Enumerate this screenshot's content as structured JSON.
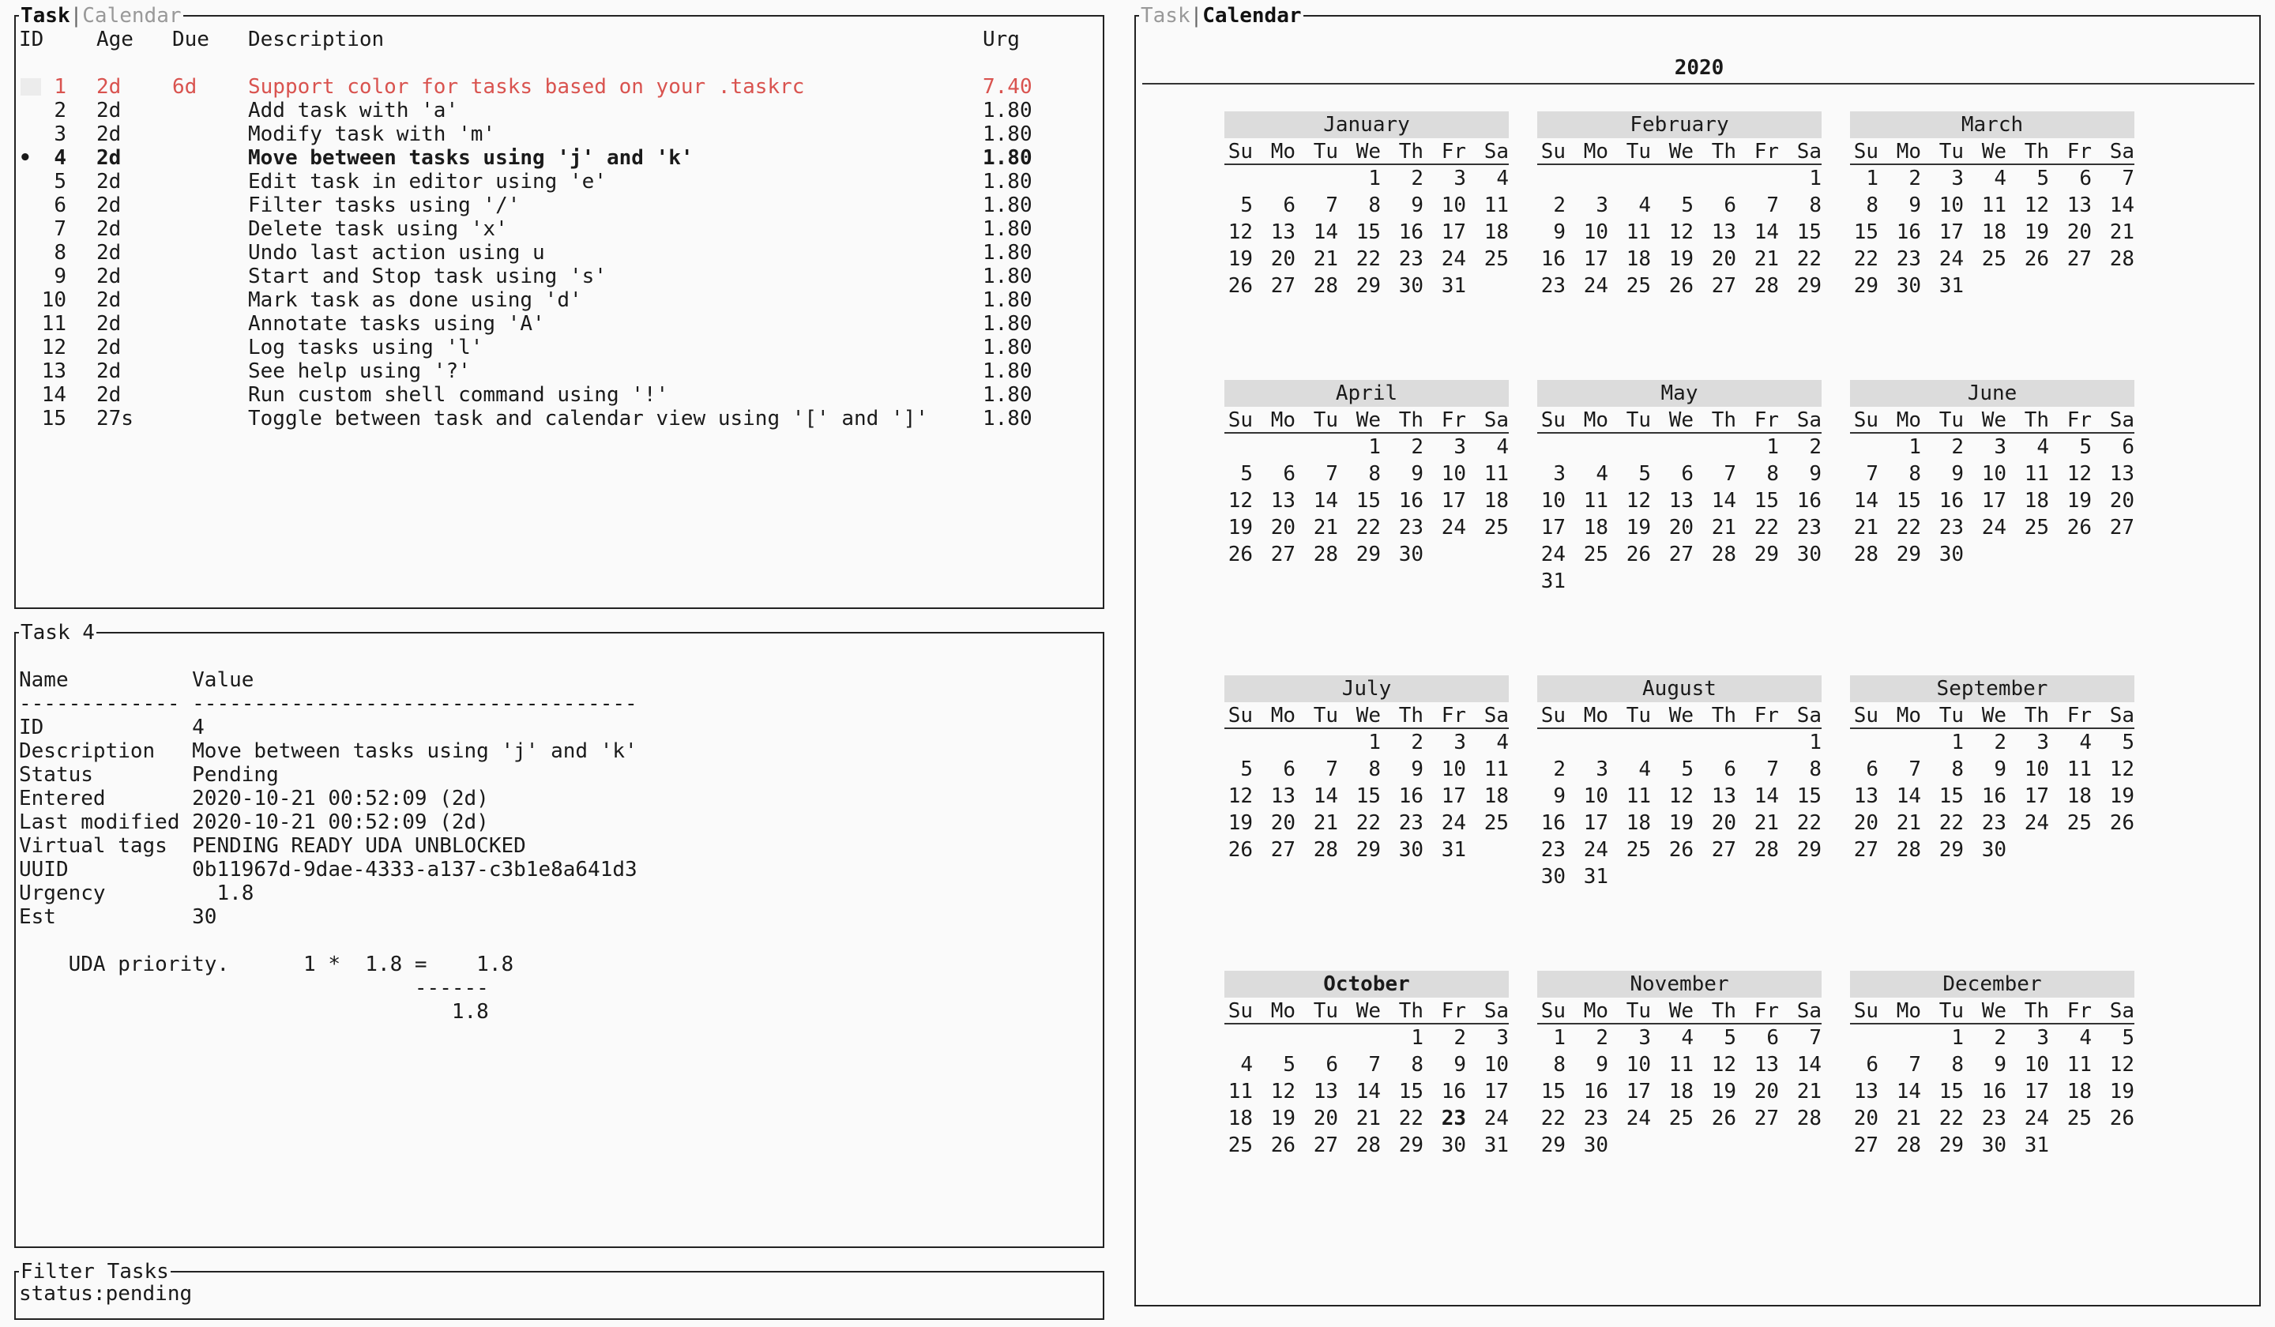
{
  "tabs": {
    "task": "Task",
    "calendar": "Calendar",
    "separator": "|"
  },
  "task_list": {
    "headers": {
      "id": "ID",
      "age": "Age",
      "due": "Due",
      "description": "Description",
      "urgency": "Urg"
    },
    "rows": [
      {
        "id": "1",
        "age": "2d",
        "due": "6d",
        "description": "Support color for tasks based on your .taskrc",
        "urgency": "7.40",
        "style": "red",
        "marker": ""
      },
      {
        "id": "2",
        "age": "2d",
        "due": "",
        "description": "Add task with 'a'",
        "urgency": "1.80",
        "style": "",
        "marker": ""
      },
      {
        "id": "3",
        "age": "2d",
        "due": "",
        "description": "Modify task with 'm'",
        "urgency": "1.80",
        "style": "",
        "marker": ""
      },
      {
        "id": "4",
        "age": "2d",
        "due": "",
        "description": "Move between tasks using 'j' and 'k'",
        "urgency": "1.80",
        "style": "bold",
        "marker": "•"
      },
      {
        "id": "5",
        "age": "2d",
        "due": "",
        "description": "Edit task in editor using 'e'",
        "urgency": "1.80",
        "style": "",
        "marker": ""
      },
      {
        "id": "6",
        "age": "2d",
        "due": "",
        "description": "Filter tasks using '/'",
        "urgency": "1.80",
        "style": "",
        "marker": ""
      },
      {
        "id": "7",
        "age": "2d",
        "due": "",
        "description": "Delete task using 'x'",
        "urgency": "1.80",
        "style": "",
        "marker": ""
      },
      {
        "id": "8",
        "age": "2d",
        "due": "",
        "description": "Undo last action using u",
        "urgency": "1.80",
        "style": "",
        "marker": ""
      },
      {
        "id": "9",
        "age": "2d",
        "due": "",
        "description": "Start and Stop task using 's'",
        "urgency": "1.80",
        "style": "",
        "marker": ""
      },
      {
        "id": "10",
        "age": "2d",
        "due": "",
        "description": "Mark task as done using 'd'",
        "urgency": "1.80",
        "style": "",
        "marker": ""
      },
      {
        "id": "11",
        "age": "2d",
        "due": "",
        "description": "Annotate tasks using 'A'",
        "urgency": "1.80",
        "style": "",
        "marker": ""
      },
      {
        "id": "12",
        "age": "2d",
        "due": "",
        "description": "Log tasks using 'l'",
        "urgency": "1.80",
        "style": "",
        "marker": ""
      },
      {
        "id": "13",
        "age": "2d",
        "due": "",
        "description": "See help using '?'",
        "urgency": "1.80",
        "style": "",
        "marker": ""
      },
      {
        "id": "14",
        "age": "2d",
        "due": "",
        "description": "Run custom shell command using '!'",
        "urgency": "1.80",
        "style": "",
        "marker": ""
      },
      {
        "id": "15",
        "age": "27s",
        "due": "",
        "description": "Toggle between task and calendar view using '[' and ']'",
        "urgency": "1.80",
        "style": "",
        "marker": ""
      }
    ]
  },
  "task_detail": {
    "title": "Task 4",
    "lines": [
      "Name          Value",
      "------------- ------------------------------------",
      "ID            4",
      "Description   Move between tasks using 'j' and 'k'",
      "Status        Pending",
      "Entered       2020-10-21 00:52:09 (2d)",
      "Last modified 2020-10-21 00:52:09 (2d)",
      "Virtual tags  PENDING READY UDA UNBLOCKED",
      "UUID          0b11967d-9dae-4333-a137-c3b1e8a641d3",
      "Urgency         1.8",
      "Est           30",
      "",
      "    UDA priority.      1 *  1.8 =    1.8",
      "                                ------",
      "                                   1.8"
    ]
  },
  "filter": {
    "title": "Filter Tasks",
    "value": "status:pending"
  },
  "calendar": {
    "year": "2020",
    "weekdays": [
      "Su",
      "Mo",
      "Tu",
      "We",
      "Th",
      "Fr",
      "Sa"
    ],
    "current_month_index": 9,
    "today": "23",
    "months": [
      {
        "name": "January",
        "first_weekday": 3,
        "days": 31
      },
      {
        "name": "February",
        "first_weekday": 6,
        "days": 29
      },
      {
        "name": "March",
        "first_weekday": 0,
        "days": 31
      },
      {
        "name": "April",
        "first_weekday": 3,
        "days": 30
      },
      {
        "name": "May",
        "first_weekday": 5,
        "days": 31
      },
      {
        "name": "June",
        "first_weekday": 1,
        "days": 30
      },
      {
        "name": "July",
        "first_weekday": 3,
        "days": 31
      },
      {
        "name": "August",
        "first_weekday": 6,
        "days": 31
      },
      {
        "name": "September",
        "first_weekday": 2,
        "days": 30
      },
      {
        "name": "October",
        "first_weekday": 4,
        "days": 31
      },
      {
        "name": "November",
        "first_weekday": 0,
        "days": 30
      },
      {
        "name": "December",
        "first_weekday": 2,
        "days": 31
      }
    ]
  }
}
